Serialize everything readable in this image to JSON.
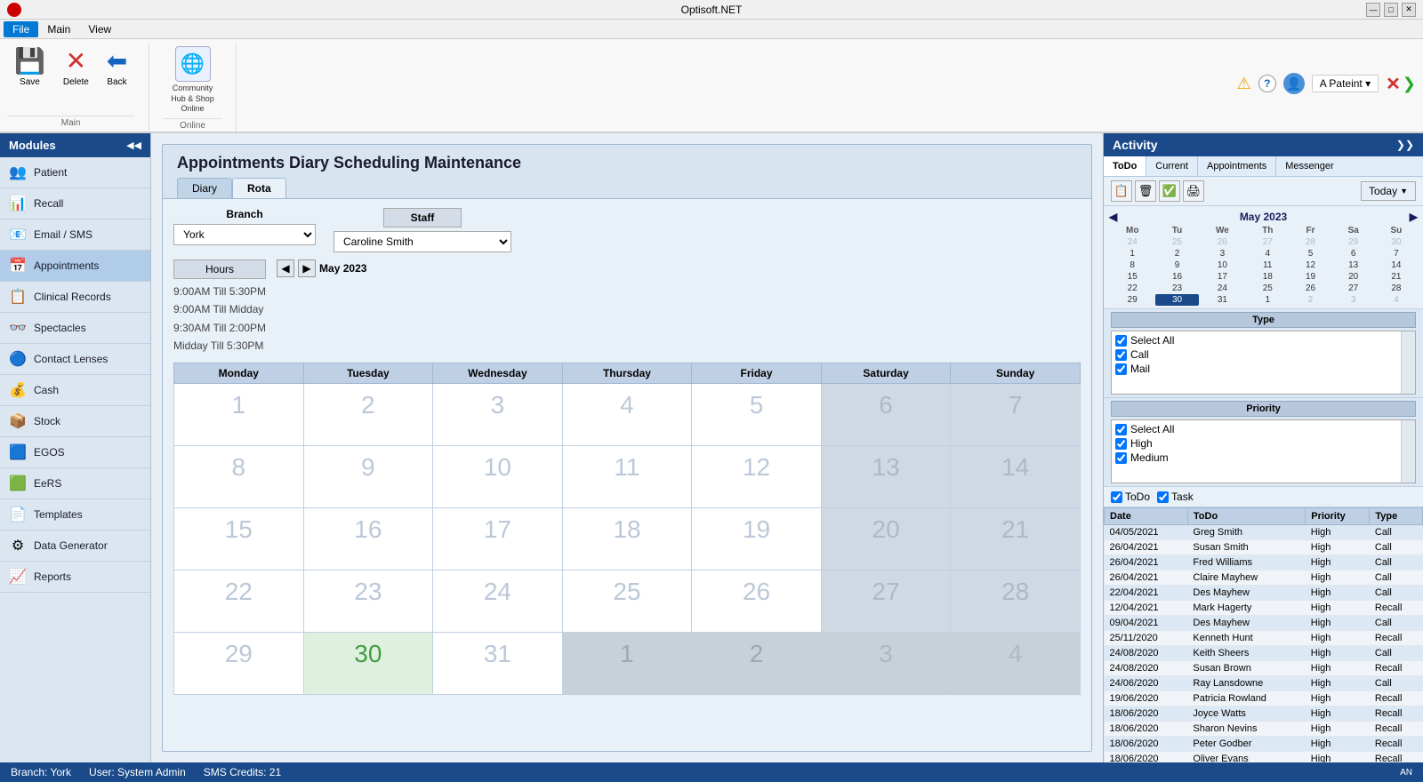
{
  "app": {
    "title": "Optisoft.NET",
    "icon": "●"
  },
  "title_bar": {
    "minimize": "—",
    "maximize": "□",
    "close": "✕"
  },
  "menu": {
    "items": [
      "File",
      "Main",
      "View"
    ]
  },
  "ribbon": {
    "main_group": "Main",
    "community_group": "Online",
    "buttons": {
      "save": "Save",
      "delete": "Delete",
      "back": "Back",
      "community_hub": "Community\nHub & Shop\nOnline"
    }
  },
  "top_right": {
    "user": "A Pateint ▾",
    "close": "✕",
    "expand": "❯"
  },
  "sidebar": {
    "title": "Modules",
    "collapse": "◀◀",
    "items": [
      {
        "label": "Patient",
        "icon": "👥"
      },
      {
        "label": "Recall",
        "icon": "📊"
      },
      {
        "label": "Email / SMS",
        "icon": "📧"
      },
      {
        "label": "Appointments",
        "icon": "📅"
      },
      {
        "label": "Clinical Records",
        "icon": "📋"
      },
      {
        "label": "Spectacles",
        "icon": "👓"
      },
      {
        "label": "Contact Lenses",
        "icon": "🔵"
      },
      {
        "label": "Cash",
        "icon": "💰"
      },
      {
        "label": "Stock",
        "icon": "📦"
      },
      {
        "label": "EGOS",
        "icon": "🟦"
      },
      {
        "label": "EeRS",
        "icon": "🟩"
      },
      {
        "label": "Templates",
        "icon": "📄"
      },
      {
        "label": "Data Generator",
        "icon": "⚙"
      },
      {
        "label": "Reports",
        "icon": "📈"
      }
    ]
  },
  "diary": {
    "title": "Appointments Diary Scheduling Maintenance",
    "tabs": [
      "Diary",
      "Rota"
    ],
    "active_tab": "Rota",
    "branch_label": "Branch",
    "branch_value": "York",
    "staff_label": "Staff",
    "staff_value": "Caroline Smith",
    "hours_label": "Hours",
    "hours_list": [
      "9:00AM Till 5:30PM",
      "9:00AM Till Midday",
      "9:30AM Till 2:00PM",
      "Midday Till 5:30PM"
    ],
    "nav_month": "May 2023",
    "days": [
      "Monday",
      "Tuesday",
      "Wednesday",
      "Thursday",
      "Friday",
      "Saturday",
      "Sunday"
    ],
    "weeks": [
      [
        "1",
        "2",
        "3",
        "4",
        "5",
        "6",
        "7"
      ],
      [
        "8",
        "9",
        "10",
        "11",
        "12",
        "13",
        "14"
      ],
      [
        "15",
        "16",
        "17",
        "18",
        "19",
        "20",
        "21"
      ],
      [
        "22",
        "23",
        "24",
        "25",
        "26",
        "27",
        "28"
      ],
      [
        "29",
        "30",
        "31",
        "1",
        "2",
        "3",
        "4"
      ]
    ],
    "today_date": "30",
    "weekend_cols": [
      5,
      6
    ],
    "last_row_gray": [
      3,
      4,
      5,
      6
    ]
  },
  "activity": {
    "title": "Activity",
    "expand": "❯❯",
    "tabs": [
      "ToDo",
      "Current",
      "Appointments",
      "Messenger"
    ],
    "active_tab": "ToDo",
    "toolbar_icons": [
      "📋",
      "🗑",
      "✅",
      "🖨"
    ],
    "today_btn": "Today",
    "mini_cal": {
      "month": "May 2023",
      "headers": [
        "Mo",
        "Tu",
        "We",
        "Th",
        "Fr",
        "Sa",
        "Su"
      ],
      "weeks": [
        [
          "24",
          "25",
          "26",
          "27",
          "28",
          "29",
          "30"
        ],
        [
          "1",
          "2",
          "3",
          "4",
          "5",
          "6",
          "7"
        ],
        [
          "8",
          "9",
          "10",
          "11",
          "12",
          "13",
          "14"
        ],
        [
          "15",
          "16",
          "17",
          "18",
          "19",
          "20",
          "21"
        ],
        [
          "22",
          "23",
          "24",
          "25",
          "26",
          "27",
          "28"
        ],
        [
          "29",
          "30",
          "31",
          "1",
          "2",
          "3",
          "4"
        ]
      ],
      "other_month_first_row": [
        0,
        1,
        2,
        3,
        4,
        5,
        6
      ],
      "today_cell": "30",
      "today_row": 5,
      "today_col": 1
    },
    "type_section": {
      "label": "Type",
      "items": [
        {
          "label": "Select All",
          "checked": true
        },
        {
          "label": "Call",
          "checked": true
        },
        {
          "label": "Mail",
          "checked": true
        }
      ]
    },
    "priority_section": {
      "label": "Priority",
      "items": [
        {
          "label": "Select All",
          "checked": true
        },
        {
          "label": "High",
          "checked": true
        },
        {
          "label": "Medium",
          "checked": true
        }
      ]
    },
    "filter_row": {
      "todo_label": "ToDo",
      "todo_checked": true,
      "task_label": "Task",
      "task_checked": true
    },
    "table": {
      "headers": [
        "Date",
        "ToDo",
        "Priority",
        "Type"
      ],
      "rows": [
        {
          "date": "04/05/2021",
          "todo": "Greg Smith",
          "priority": "High",
          "type": "Call"
        },
        {
          "date": "26/04/2021",
          "todo": "Susan Smith",
          "priority": "High",
          "type": "Call"
        },
        {
          "date": "26/04/2021",
          "todo": "Fred Williams",
          "priority": "High",
          "type": "Call"
        },
        {
          "date": "26/04/2021",
          "todo": "Claire Mayhew",
          "priority": "High",
          "type": "Call"
        },
        {
          "date": "22/04/2021",
          "todo": "Des Mayhew",
          "priority": "High",
          "type": "Call"
        },
        {
          "date": "12/04/2021",
          "todo": "Mark Hagerty",
          "priority": "High",
          "type": "Recall"
        },
        {
          "date": "09/04/2021",
          "todo": "Des Mayhew",
          "priority": "High",
          "type": "Call"
        },
        {
          "date": "25/11/2020",
          "todo": "Kenneth Hunt",
          "priority": "High",
          "type": "Recall"
        },
        {
          "date": "24/08/2020",
          "todo": "Keith Sheers",
          "priority": "High",
          "type": "Call"
        },
        {
          "date": "24/08/2020",
          "todo": "Susan Brown",
          "priority": "High",
          "type": "Recall"
        },
        {
          "date": "24/06/2020",
          "todo": "Ray Lansdowne",
          "priority": "High",
          "type": "Call"
        },
        {
          "date": "19/06/2020",
          "todo": "Patricia Rowland",
          "priority": "High",
          "type": "Recall"
        },
        {
          "date": "18/06/2020",
          "todo": "Joyce Watts",
          "priority": "High",
          "type": "Recall"
        },
        {
          "date": "18/06/2020",
          "todo": "Sharon Nevins",
          "priority": "High",
          "type": "Recall"
        },
        {
          "date": "18/06/2020",
          "todo": "Peter Godber",
          "priority": "High",
          "type": "Recall"
        },
        {
          "date": "18/06/2020",
          "todo": "Oliver Evans",
          "priority": "High",
          "type": "Recall"
        }
      ]
    }
  },
  "status_bar": {
    "branch": "Branch: York",
    "user": "User: System Admin",
    "sms": "SMS Credits: 21"
  }
}
